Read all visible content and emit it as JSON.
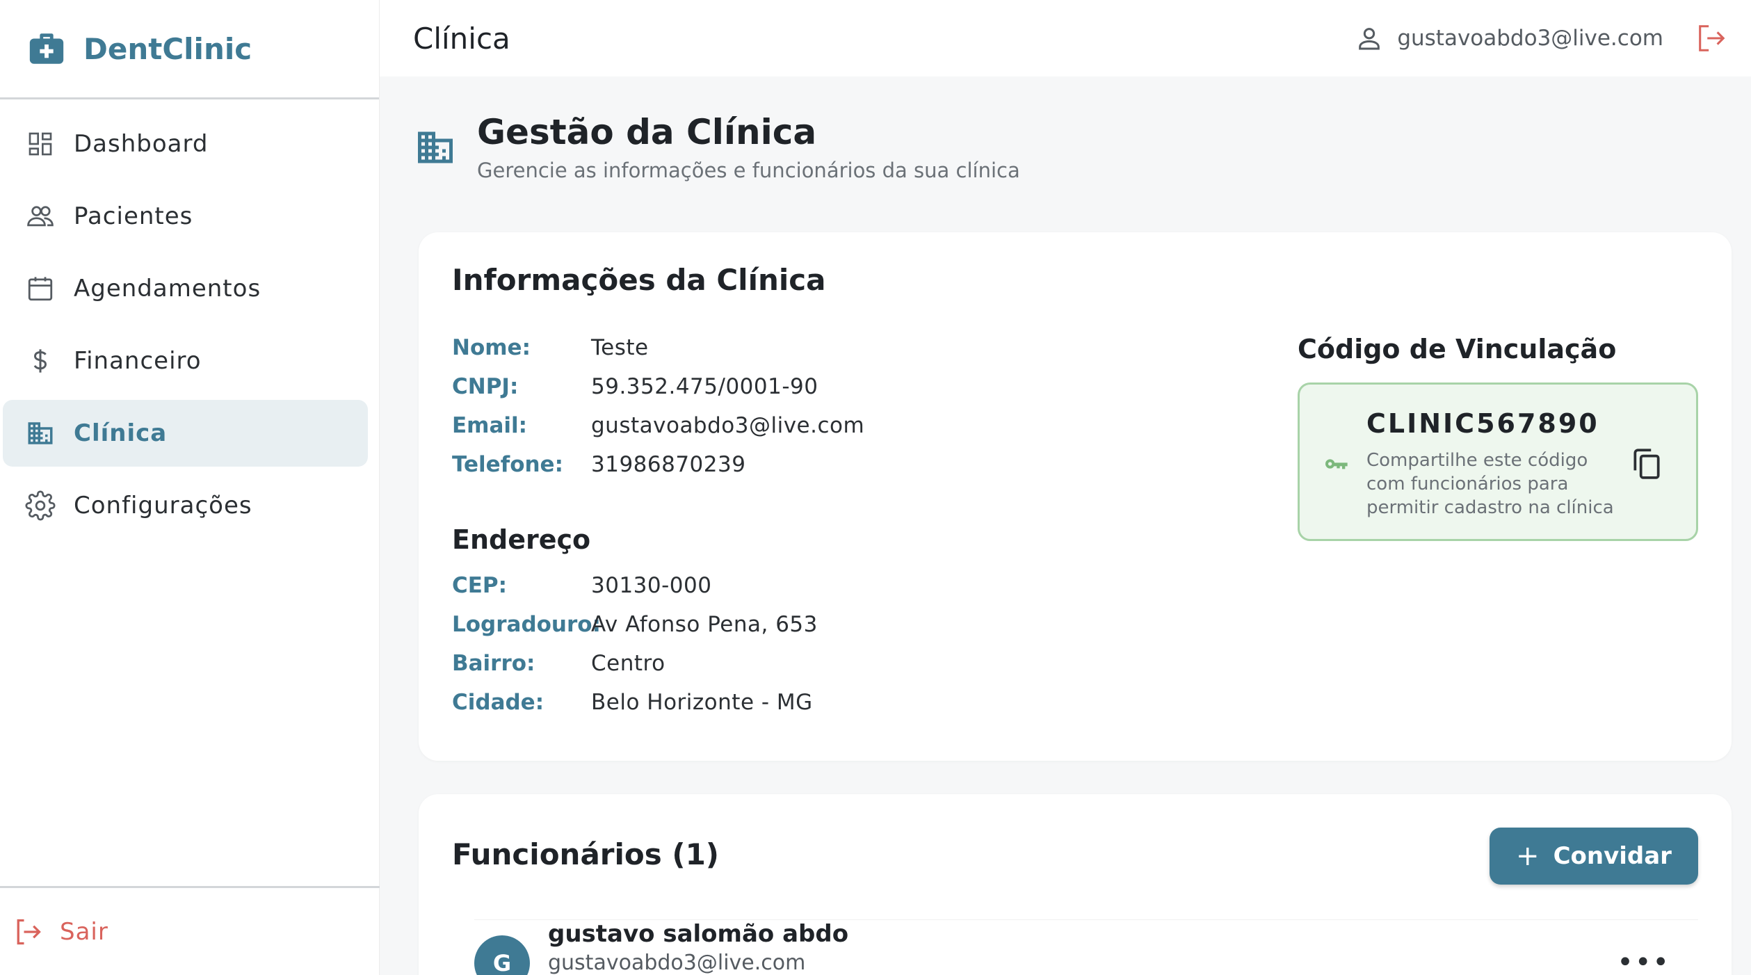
{
  "app": {
    "name": "DentClinic",
    "accent": "#3f7a94",
    "danger": "#d9635c",
    "success_bg": "#eef7ee"
  },
  "sidebar": {
    "items": [
      {
        "label": "Dashboard",
        "icon": "dashboard-icon"
      },
      {
        "label": "Pacientes",
        "icon": "users-icon"
      },
      {
        "label": "Agendamentos",
        "icon": "calendar-icon"
      },
      {
        "label": "Financeiro",
        "icon": "dollar-icon"
      },
      {
        "label": "Clínica",
        "icon": "building-icon",
        "active": true
      },
      {
        "label": "Configurações",
        "icon": "gear-icon"
      }
    ],
    "logout_label": "Sair"
  },
  "topbar": {
    "title": "Clínica",
    "user_email": "gustavoabdo3@live.com"
  },
  "page": {
    "title": "Gestão da Clínica",
    "subtitle": "Gerencie as informações e funcionários da sua clínica"
  },
  "info": {
    "title": "Informações da Clínica",
    "fields": [
      {
        "label": "Nome:",
        "value": "Teste"
      },
      {
        "label": "CNPJ:",
        "value": "59.352.475/0001-90"
      },
      {
        "label": "Email:",
        "value": "gustavoabdo3@live.com"
      },
      {
        "label": "Telefone:",
        "value": "31986870239"
      }
    ],
    "address_title": "Endereço",
    "address": [
      {
        "label": "CEP:",
        "value": "30130-000"
      },
      {
        "label": "Logradouro:",
        "value": "Av Afonso Pena, 653"
      },
      {
        "label": "Bairro:",
        "value": "Centro"
      },
      {
        "label": "Cidade:",
        "value": "Belo Horizonte - MG"
      }
    ]
  },
  "link_code": {
    "title": "Código de Vinculação",
    "code": "CLINIC567890",
    "description": "Compartilhe este código com funcionários para permitir cadastro na clínica"
  },
  "staff": {
    "title": "Funcionários (1)",
    "invite_label": "Convidar",
    "members": [
      {
        "initial": "G",
        "name": "gustavo salomão abdo",
        "email": "gustavoabdo3@live.com",
        "more": "•••"
      }
    ]
  }
}
